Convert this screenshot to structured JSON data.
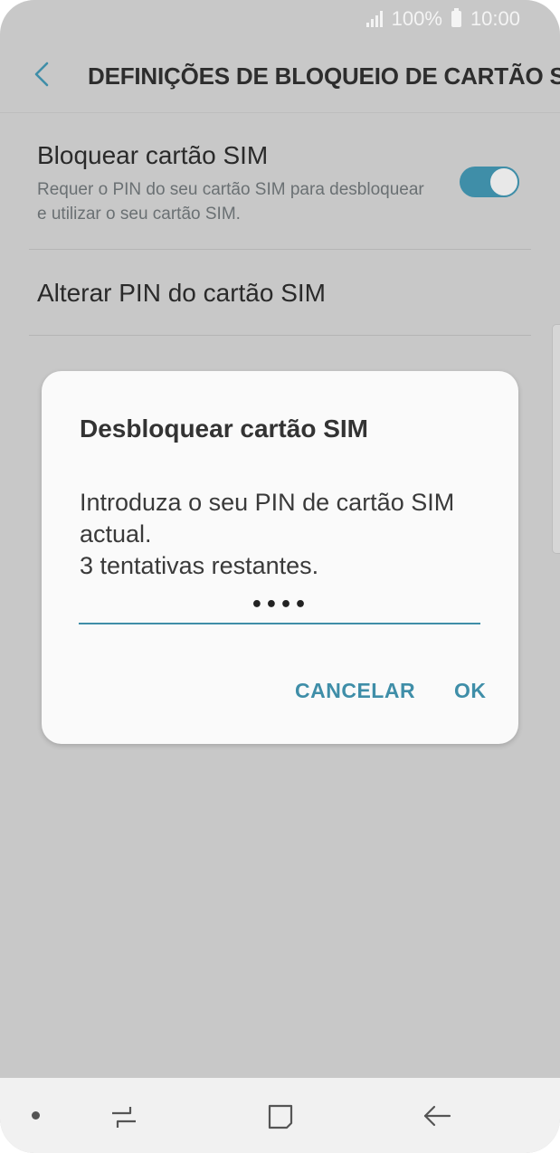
{
  "status_bar": {
    "battery_text": "100%",
    "time": "10:00"
  },
  "app_bar": {
    "title": "DEFINIÇÕES DE BLOQUEIO DE CARTÃO SIM"
  },
  "settings": {
    "lock_sim": {
      "title": "Bloquear cartão SIM",
      "description": "Requer o PIN do seu cartão SIM para desbloquear e utilizar o seu cartão SIM.",
      "enabled": true
    },
    "change_pin": {
      "title": "Alterar PIN do cartão SIM"
    }
  },
  "dialog": {
    "title": "Desbloquear cartão SIM",
    "message_line1": "Introduza o seu PIN de cartão SIM actual.",
    "message_line2": "3 tentativas restantes.",
    "pin_masked": "••••",
    "cancel_label": "CANCELAR",
    "ok_label": "OK"
  },
  "colors": {
    "accent": "#3f8ea8",
    "background_dimmed": "#c8c8c8",
    "dialog_bg": "#fafafa",
    "navbar_bg": "#f1f1f1"
  },
  "nav_icons": [
    "recents-icon",
    "home-icon",
    "back-icon"
  ]
}
